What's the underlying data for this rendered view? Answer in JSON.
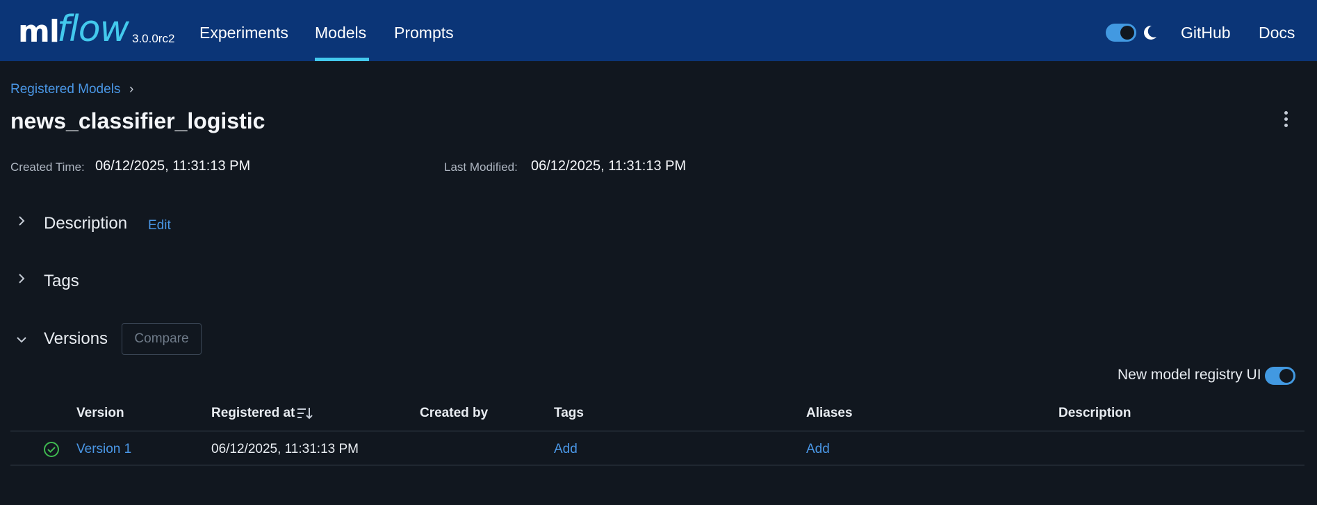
{
  "header": {
    "logo": {
      "text_ml": "ml",
      "text_flow": "flow",
      "version": "3.0.0rc2"
    },
    "nav": [
      {
        "label": "Experiments",
        "active": false
      },
      {
        "label": "Models",
        "active": true
      },
      {
        "label": "Prompts",
        "active": false
      }
    ],
    "theme_toggle": {
      "state": "dark",
      "icon": "moon-icon"
    },
    "links": {
      "github": "GitHub",
      "docs": "Docs"
    },
    "accent_color": "#43c9ed",
    "background_color": "#0b3577"
  },
  "breadcrumb": {
    "label": "Registered Models",
    "separator": "›"
  },
  "page": {
    "title": "news_classifier_logistic",
    "created_label": "Created Time:",
    "created_value": "06/12/2025, 11:31:13 PM",
    "modified_label": "Last Modified:",
    "modified_value": "06/12/2025, 11:31:13 PM"
  },
  "sections": {
    "description": {
      "title": "Description",
      "edit_label": "Edit",
      "expanded": false
    },
    "tags": {
      "title": "Tags",
      "expanded": false
    },
    "versions": {
      "title": "Versions",
      "compare_label": "Compare",
      "expanded": true
    }
  },
  "registry_ui": {
    "label": "New model registry UI",
    "enabled": true
  },
  "table": {
    "columns": [
      "Version",
      "Registered at",
      "Created by",
      "Tags",
      "Aliases",
      "Description"
    ],
    "rows": [
      {
        "status": "ready",
        "version": "Version 1",
        "registered_at": "06/12/2025, 11:31:13 PM",
        "created_by": "",
        "tags": "Add",
        "aliases": "Add",
        "description": ""
      }
    ]
  },
  "colors": {
    "link": "#4a97e6",
    "page_background": "#11171f",
    "success": "#3fb950"
  }
}
